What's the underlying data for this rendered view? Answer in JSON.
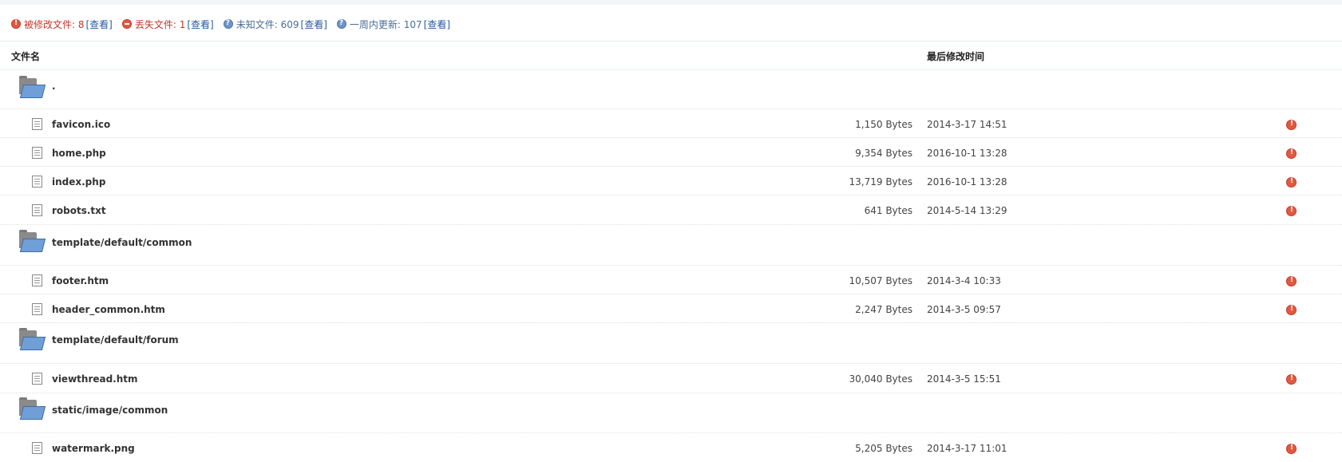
{
  "summary": [
    {
      "type": "red",
      "icon": "exclamation-icon",
      "label": "被修改文件: 8",
      "link": "[查看]"
    },
    {
      "type": "red",
      "icon": "minus-circle-icon",
      "label": "丢失文件: 1",
      "link": "[查看]"
    },
    {
      "type": "blue",
      "icon": "question-icon",
      "label": "未知文件: 609",
      "link": "[查看]"
    },
    {
      "type": "blue",
      "icon": "question-icon",
      "label": "一周内更新: 107",
      "link": "[查看]"
    }
  ],
  "table": {
    "col_filename": "文件名",
    "col_modified": "最后修改时间",
    "rows": [
      {
        "kind": "folder",
        "name": "."
      },
      {
        "kind": "file",
        "name": "favicon.ico",
        "size": "1,150 Bytes",
        "time": "2014-3-17 14:51"
      },
      {
        "kind": "file",
        "name": "home.php",
        "size": "9,354 Bytes",
        "time": "2016-10-1 13:28"
      },
      {
        "kind": "file",
        "name": "index.php",
        "size": "13,719 Bytes",
        "time": "2016-10-1 13:28"
      },
      {
        "kind": "file",
        "name": "robots.txt",
        "size": "641 Bytes",
        "time": "2014-5-14 13:29"
      },
      {
        "kind": "folder",
        "name": "template/default/common"
      },
      {
        "kind": "file",
        "name": "footer.htm",
        "size": "10,507 Bytes",
        "time": "2014-3-4 10:33"
      },
      {
        "kind": "file",
        "name": "header_common.htm",
        "size": "2,247 Bytes",
        "time": "2014-3-5 09:57"
      },
      {
        "kind": "folder",
        "name": "template/default/forum"
      },
      {
        "kind": "file",
        "name": "viewthread.htm",
        "size": "30,040 Bytes",
        "time": "2014-3-5 15:51"
      },
      {
        "kind": "folder",
        "name": "static/image/common"
      },
      {
        "kind": "file",
        "name": "watermark.png",
        "size": "5,205 Bytes",
        "time": "2014-3-17 11:01"
      }
    ]
  },
  "colors": {
    "warning": "#e05a42",
    "link": "#2b5a9c",
    "modified_text": "#c0392b",
    "info_text": "#4a6d96"
  }
}
